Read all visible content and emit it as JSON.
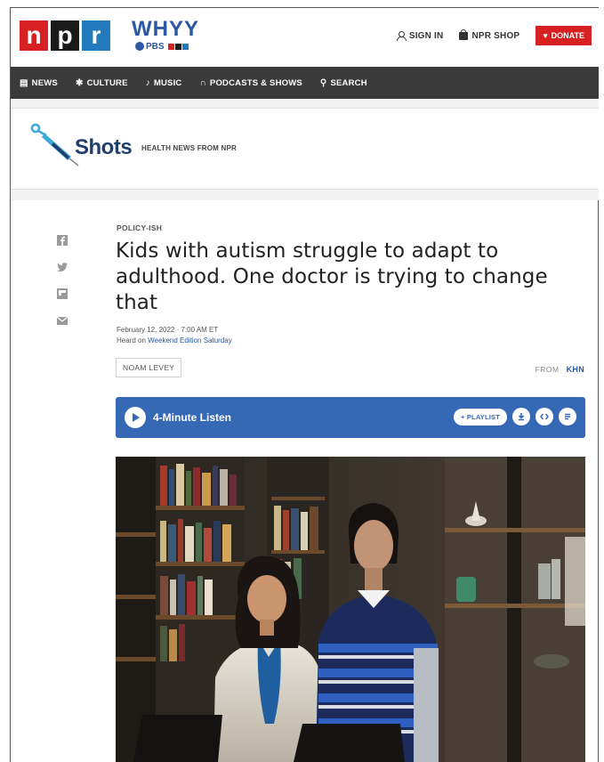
{
  "header": {
    "logo_letters": [
      "n",
      "p",
      "r"
    ],
    "station_name": "WHYY",
    "station_sub_pbs": "PBS",
    "sign_in": "SIGN IN",
    "shop": "NPR SHOP",
    "donate": "DONATE"
  },
  "nav": {
    "items": [
      {
        "label": "NEWS",
        "icon": "news-icon"
      },
      {
        "label": "CULTURE",
        "icon": "culture-icon"
      },
      {
        "label": "MUSIC",
        "icon": "music-icon"
      },
      {
        "label": "PODCASTS & SHOWS",
        "icon": "headphones-icon"
      },
      {
        "label": "SEARCH",
        "icon": "search-icon"
      }
    ]
  },
  "blog": {
    "name": "Shots",
    "tagline": "HEALTH NEWS FROM NPR"
  },
  "article": {
    "slug": "POLICY-ISH",
    "headline": "Kids with autism struggle to adapt to adulthood. One doctor is trying to change that",
    "date": "February 12, 2022 · 7:00 AM ET",
    "heard_on_prefix": "Heard on ",
    "heard_on_program": "Weekend Edition Saturday",
    "byline": "NOAM LEVEY",
    "from_label": "FROM",
    "from_source": "KHN"
  },
  "audio": {
    "label": "4-Minute Listen",
    "playlist": "+ PLAYLIST"
  },
  "colors": {
    "npr_red": "#d62021",
    "npr_blue": "#237bbd",
    "audio_blue": "#3568b5",
    "nav_bg": "#3a3a3a"
  }
}
